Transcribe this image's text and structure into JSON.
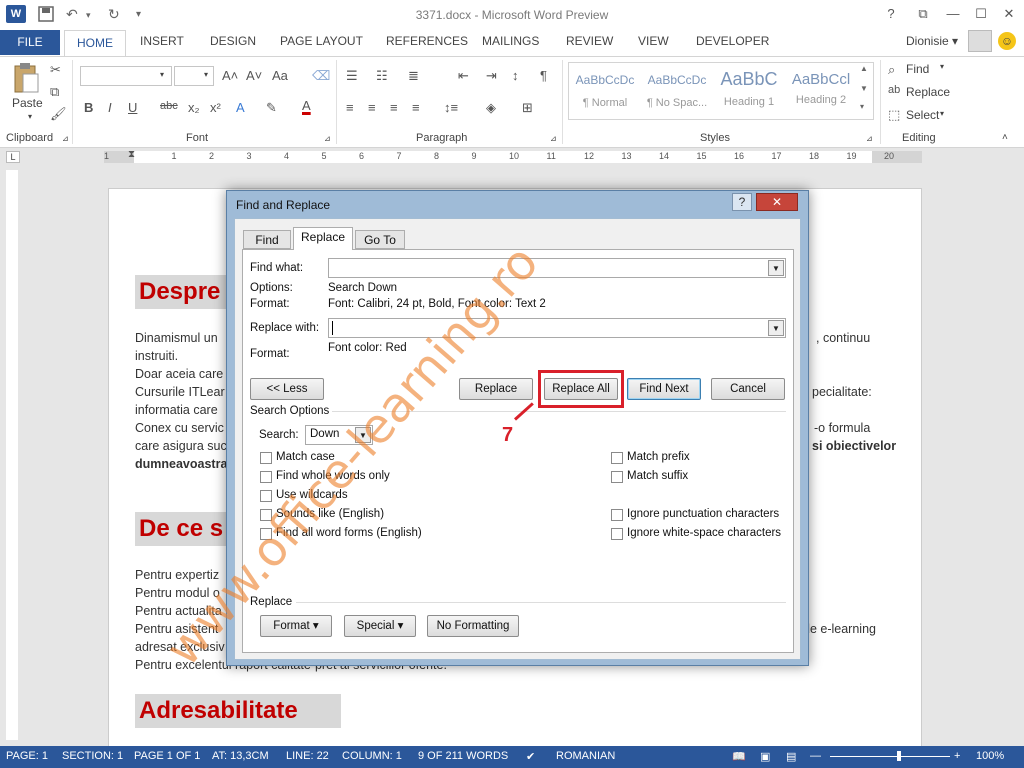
{
  "app": {
    "logo": "W",
    "doc_title": "3371.docx - Microsoft Word Preview"
  },
  "qat": {
    "save_icon": "save-icon",
    "undo_icon": "undo-icon",
    "redo_icon": "redo-icon"
  },
  "window": {
    "help": "?",
    "restore_ribbon": "⧉",
    "minimize": "—",
    "maximize": "☐",
    "close": "✕"
  },
  "ribbon_tabs": [
    "FILE",
    "HOME",
    "INSERT",
    "DESIGN",
    "PAGE LAYOUT",
    "REFERENCES",
    "MAILINGS",
    "REVIEW",
    "VIEW",
    "DEVELOPER"
  ],
  "user": {
    "name": "Dionisie ▾"
  },
  "ribbon": {
    "clipboard": {
      "paste": "Paste",
      "label": "Clipboard"
    },
    "font": {
      "label": "Font",
      "bold": "B",
      "italic": "I",
      "underline": "U",
      "strike": "abc",
      "sub": "x₂",
      "sup": "x²",
      "grow": "A˄",
      "shrink": "A˅",
      "case": "Aa"
    },
    "paragraph": {
      "label": "Paragraph"
    },
    "styles": {
      "label": "Styles",
      "items": [
        {
          "sample": "AaBbCcDc",
          "name": "¶ Normal"
        },
        {
          "sample": "AaBbCcDc",
          "name": "¶ No Spac..."
        },
        {
          "sample": "AaBbC",
          "name": "Heading 1"
        },
        {
          "sample": "AaBbCcl",
          "name": "Heading 2"
        }
      ]
    },
    "editing": {
      "label": "Editing",
      "find": "Find",
      "replace": "Replace",
      "select": "Select"
    }
  },
  "ruler": {
    "numbers": [
      "1",
      "1",
      "2",
      "3",
      "4",
      "5",
      "6",
      "7",
      "8",
      "9",
      "10",
      "11",
      "12",
      "13",
      "14",
      "15",
      "16",
      "17",
      "18",
      "19",
      "20"
    ]
  },
  "document": {
    "heading1": "Despre",
    "para1": [
      "Dinamismul un",
      "instruiti.",
      "Doar aceia care",
      "Cursurile ITLear",
      "informatia care",
      "Conex cu servic",
      "care asigura suc",
      "dumneavoastra"
    ],
    "para1_right": [
      ", continuu",
      "",
      "",
      "pecialitate:",
      "",
      "-o formula",
      "si obiectivelor",
      ""
    ],
    "heading2": "De ce s",
    "para2": [
      "Pentru expertiz",
      "Pentru modul o",
      "Pentru actualita",
      "Pentru asistent",
      "adresat exclusiv",
      "Pentru excelentul raport calitate-pret al serviciilor oferite."
    ],
    "para2_right": "de e-learning",
    "heading3": "Adresabilitate"
  },
  "status": {
    "page": "PAGE: 1",
    "section": "SECTION: 1",
    "pages": "PAGE 1 OF 1",
    "at": "AT: 13,3CM",
    "line": "LINE: 22",
    "column": "COLUMN: 1",
    "words": "9 OF 211 WORDS",
    "lang": "ROMANIAN",
    "zoom": "100%"
  },
  "dialog": {
    "title": "Find and Replace",
    "tabs": [
      "Find",
      "Replace",
      "Go To"
    ],
    "find_label": "Find what:",
    "find_value": "",
    "options_label": "Options:",
    "options_value": "Search Down",
    "format_label": "Format:",
    "format_value": "Font: Calibri, 24 pt, Bold, Font color: Text 2",
    "replace_label": "Replace with:",
    "replace_value": "",
    "replace_format_label": "Format:",
    "replace_format_value": "Font color: Red",
    "buttons": {
      "less": "<< Less",
      "replace": "Replace",
      "replace_all": "Replace All",
      "find_next": "Find Next",
      "cancel": "Cancel"
    },
    "search_options_label": "Search Options",
    "search_label": "Search:",
    "search_value": "Down",
    "checks_left": [
      "Match case",
      "Find whole words only",
      "Use wildcards",
      "Sounds like (English)",
      "Find all word forms (English)"
    ],
    "checks_right": [
      "Match prefix",
      "Match suffix",
      "",
      "Ignore punctuation characters",
      "Ignore white-space characters"
    ],
    "replace_section_label": "Replace",
    "bottom_buttons": {
      "format": "Format ▾",
      "special": "Special ▾",
      "no_formatting": "No Formatting"
    }
  },
  "annotation": {
    "step": "7",
    "color": "#d9202a"
  },
  "watermark": "www.office-learning.ro",
  "colors": {
    "accent": "#2b579a",
    "heading": "#c00000",
    "watermark": "#ee7f2a"
  }
}
